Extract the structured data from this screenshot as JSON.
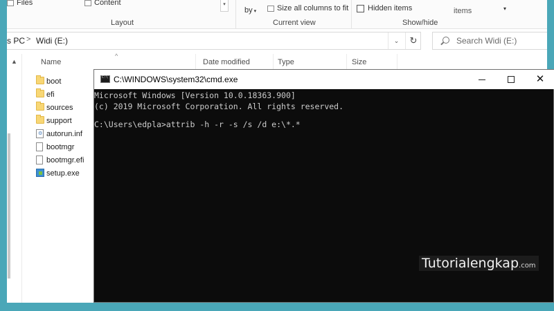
{
  "ribbon": {
    "files_label": "Files",
    "content_label": "Content",
    "by_label": "by",
    "size_columns_label": "Size all columns to fit",
    "hidden_items_label": "Hidden items",
    "items_label": "items",
    "layout_group": "Layout",
    "current_view_group": "Current view",
    "show_hide_group": "Show/hide"
  },
  "address": {
    "crumb_pc": "s PC",
    "crumb_drive": "Widi (E:)",
    "separator": ">",
    "refresh_glyph": "↻"
  },
  "search": {
    "placeholder": "Search Widi (E:)"
  },
  "columns": {
    "name": "Name",
    "date_modified": "Date modified",
    "type": "Type",
    "size": "Size"
  },
  "files": [
    {
      "name": "boot",
      "icon": "folder-icon"
    },
    {
      "name": "efi",
      "icon": "folder-icon"
    },
    {
      "name": "sources",
      "icon": "folder-icon"
    },
    {
      "name": "support",
      "icon": "folder-icon"
    },
    {
      "name": "autorun.inf",
      "icon": "settings-file-icon"
    },
    {
      "name": "bootmgr",
      "icon": "file-icon"
    },
    {
      "name": "bootmgr.efi",
      "icon": "file-icon"
    },
    {
      "name": "setup.exe",
      "icon": "setup-exe-icon"
    }
  ],
  "cmd": {
    "title": "C:\\WINDOWS\\system32\\cmd.exe",
    "close_glyph": "✕",
    "lines": [
      "Microsoft Windows [Version 10.0.18363.900]",
      "(c) 2019 Microsoft Corporation. All rights reserved.",
      "",
      "C:\\Users\\edpla>attrib -h -r -s /s /d e:\\*.*"
    ]
  },
  "watermark": {
    "text": "Tutorialengkap",
    "suffix": ".com"
  },
  "colors": {
    "desktop_background": "#4aa7b8",
    "console_background": "#0c0c0c",
    "console_text": "#cccccc",
    "folder": "#f8d775"
  }
}
